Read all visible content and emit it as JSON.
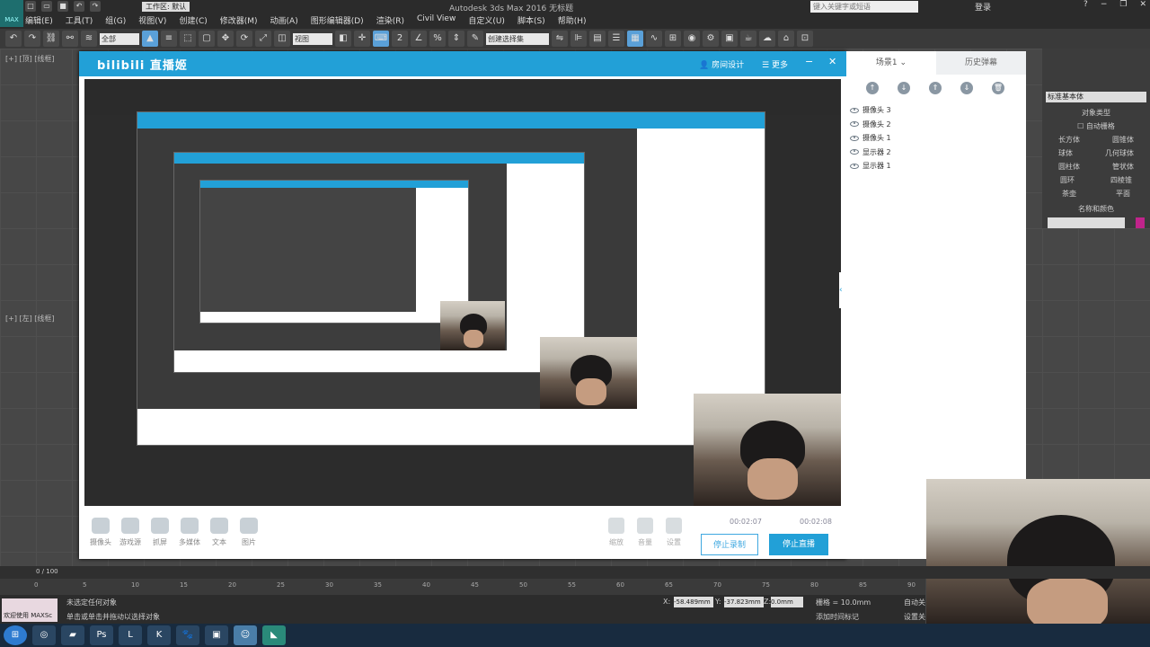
{
  "app": {
    "title": "Autodesk 3ds Max 2016    无标题",
    "workspace": "工作区: 默认",
    "search_placeholder": "键入关键字或短语",
    "login": "登录",
    "max_badge": "MAX"
  },
  "menus": [
    "编辑(E)",
    "工具(T)",
    "组(G)",
    "视图(V)",
    "创建(C)",
    "修改器(M)",
    "动画(A)",
    "图形编辑器(D)",
    "渲染(R)",
    "Civil View",
    "自定义(U)",
    "脚本(S)",
    "帮助(H)"
  ],
  "toolbar": {
    "select_filter": "全部",
    "ref_coord": "视图",
    "named_sel_placeholder": "创建选择集"
  },
  "viewports": {
    "top_label": "[+] [顶] [线框]",
    "left_label": "[+] [左] [线框]"
  },
  "bili": {
    "logo": "bilibili 直播姬",
    "room_settings": "房间设计",
    "more": "更多",
    "sources": [
      {
        "label": "摄像头",
        "icon": "camera-icon"
      },
      {
        "label": "游戏源",
        "icon": "gamepad-icon"
      },
      {
        "label": "抓屏",
        "icon": "screen-capture-icon"
      },
      {
        "label": "多媒体",
        "icon": "media-icon"
      },
      {
        "label": "文本",
        "icon": "text-icon"
      },
      {
        "label": "图片",
        "icon": "image-icon"
      }
    ],
    "controls": [
      {
        "label": "缩放",
        "icon": "zoom-icon"
      },
      {
        "label": "音量",
        "icon": "volume-icon"
      },
      {
        "label": "设置",
        "icon": "settings-icon"
      }
    ],
    "record_time": "00:02:07",
    "live_time": "00:02:08",
    "stop_record": "停止录制",
    "stop_live": "停止直播"
  },
  "panel": {
    "tab_scene": "场景1",
    "tab_history": "历史弹幕",
    "layers": [
      "摄像头 3",
      "摄像头 2",
      "摄像头 1",
      "显示器 2",
      "显示器 1"
    ]
  },
  "command_panel": {
    "dropdown": "标准基本体",
    "section": "对象类型",
    "autogrid": "自动栅格",
    "objects": [
      "长方体",
      "圆锥体",
      "球体",
      "几何球体",
      "圆柱体",
      "管状体",
      "圆环",
      "四棱锥",
      "茶壶",
      "平面"
    ],
    "name_color": "名称和颜色"
  },
  "timeline": {
    "frame": "0 / 100",
    "ticks": [
      "0",
      "5",
      "10",
      "15",
      "20",
      "25",
      "30",
      "35",
      "40",
      "45",
      "50",
      "55",
      "60",
      "65",
      "70",
      "75",
      "80",
      "85",
      "90"
    ]
  },
  "status": {
    "welcome": "欢迎使用 MAXSc",
    "msg1": "未选定任何对象",
    "msg2": "单击或单击并拖动以选择对象",
    "x": "-58.489mm",
    "y": "-37.823mm",
    "z": "0.0mm",
    "grid": "栅格 = 10.0mm",
    "autokey": "自动关",
    "setkey": "设置关",
    "add_time_tag": "添加时间标记"
  },
  "colors": {
    "bili_blue": "#22a0d7",
    "magenta": "#c0248b"
  }
}
